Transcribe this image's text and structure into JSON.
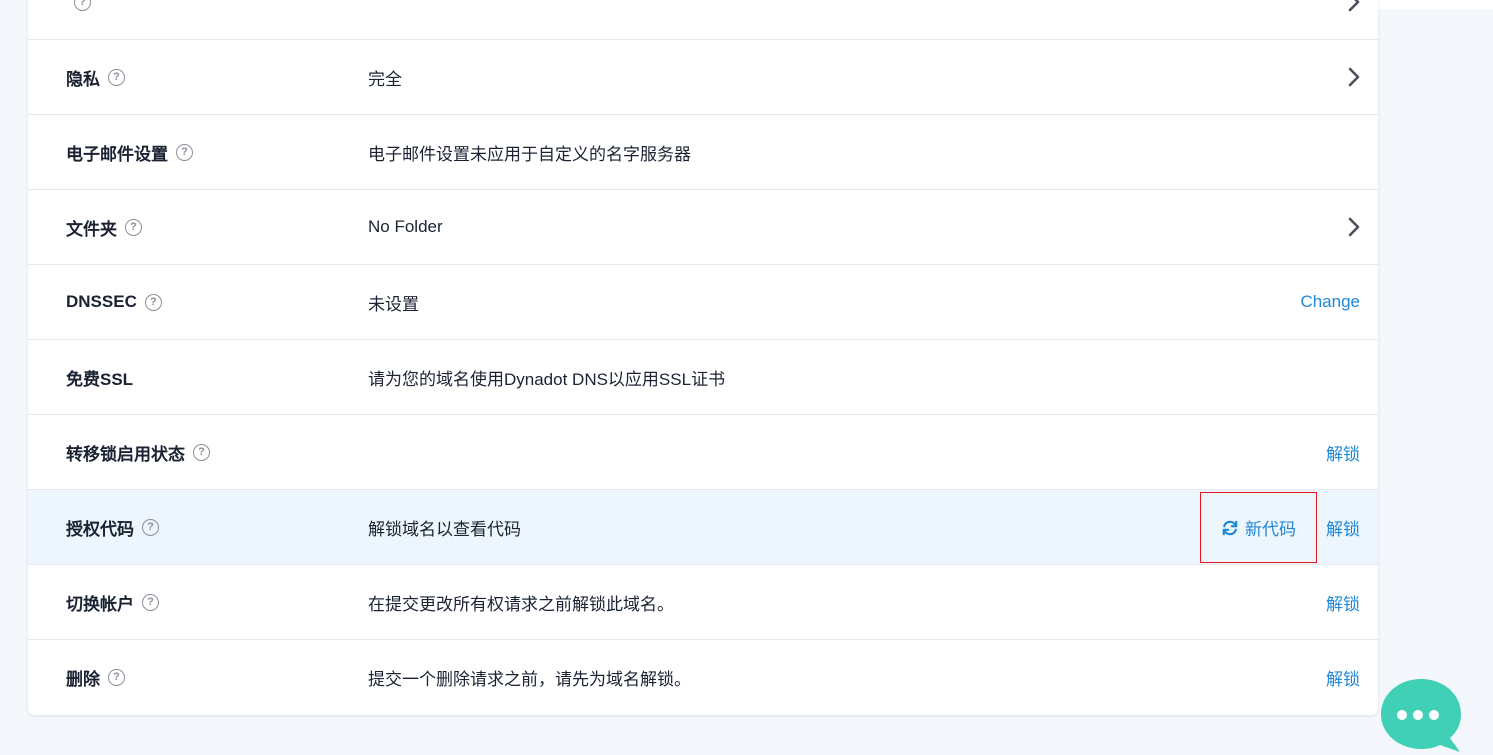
{
  "rows": [
    {
      "label": "",
      "value": "",
      "has_help": true,
      "chevron": true
    },
    {
      "label": "隐私",
      "value": "完全",
      "has_help": true,
      "chevron": true
    },
    {
      "label": "电子邮件设置",
      "value": "电子邮件设置未应用于自定义的名字服务器",
      "has_help": true
    },
    {
      "label": "文件夹",
      "value": "No Folder",
      "has_help": true,
      "chevron": true
    },
    {
      "label": "DNSSEC",
      "value": "未设置",
      "has_help": true,
      "action": "Change"
    },
    {
      "label": "免费SSL",
      "value": "请为您的域名使用Dynadot DNS以应用SSL证书",
      "has_help": false
    },
    {
      "label": "转移锁启用状态",
      "value": "",
      "has_help": true,
      "action": "解锁"
    },
    {
      "label": "授权代码",
      "value": "解锁域名以查看代码",
      "has_help": true,
      "action": "解锁",
      "secondary_action": "新代码",
      "highlight": true
    },
    {
      "label": "切换帐户",
      "value": "在提交更改所有权请求之前解锁此域名。",
      "has_help": true,
      "action": "解锁"
    },
    {
      "label": "删除",
      "value": "提交一个删除请求之前，请先为域名解锁。",
      "has_help": true,
      "action": "解锁"
    }
  ],
  "help_glyph": "?",
  "icons": {
    "chevron": "chevron-right-icon",
    "refresh": "refresh-icon",
    "help": "question-circle-icon",
    "chat": "chat-bubble-icon"
  },
  "colors": {
    "link": "#1e88d9",
    "highlight_row": "#edf5fd",
    "annotation_box": "#e0171e",
    "chat_bubble": "#3fd0b5"
  }
}
